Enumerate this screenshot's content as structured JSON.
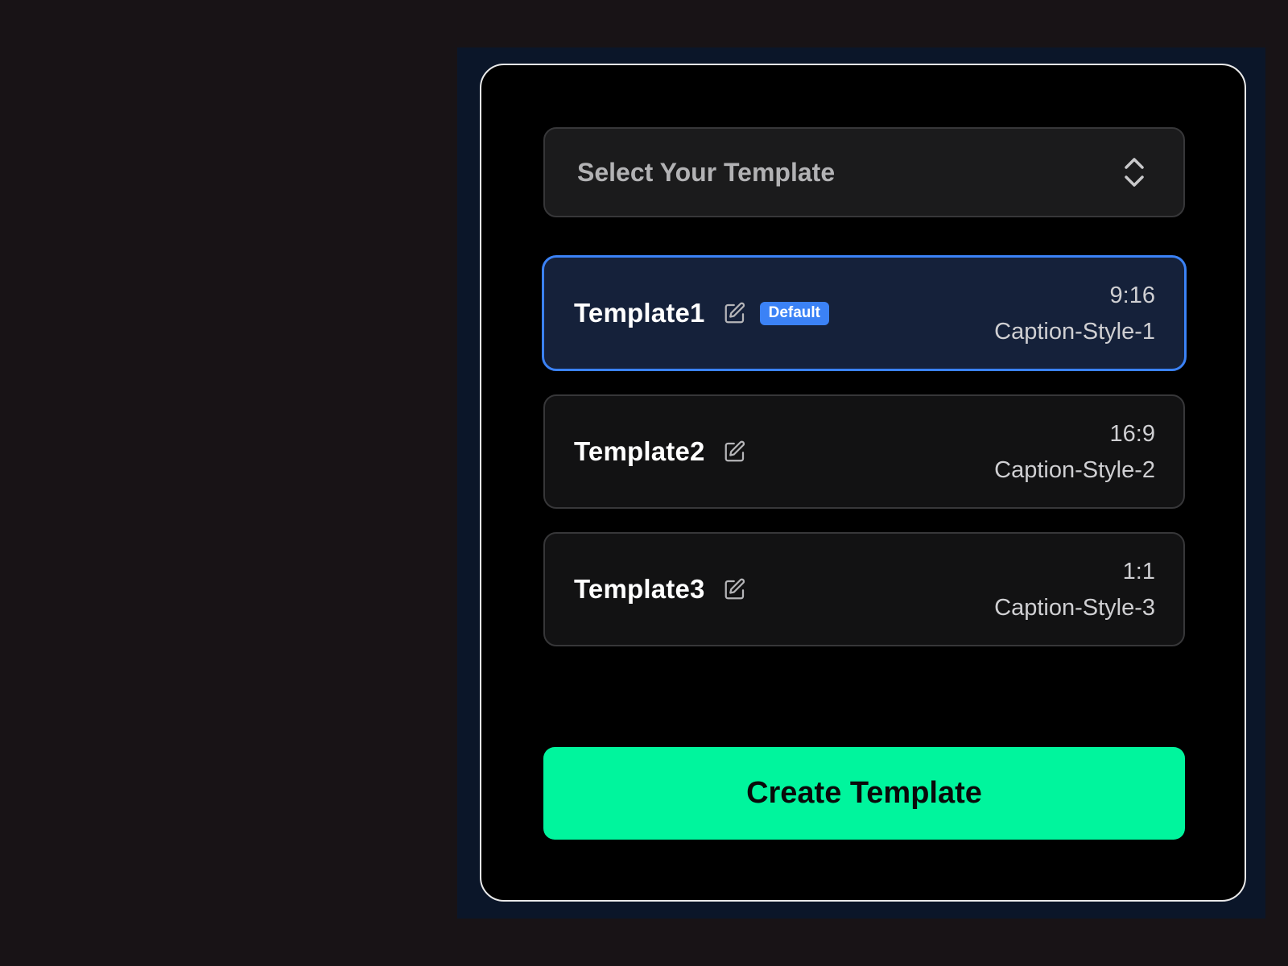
{
  "selector": {
    "label": "Select Your Template",
    "icon": "chevron-up-down-icon"
  },
  "templates": [
    {
      "name": "Template1",
      "ratio": "9:16",
      "caption_style": "Caption-Style-1",
      "badge": "Default",
      "selected": true
    },
    {
      "name": "Template2",
      "ratio": "16:9",
      "caption_style": "Caption-Style-2",
      "badge": null,
      "selected": false
    },
    {
      "name": "Template3",
      "ratio": "1:1",
      "caption_style": "Caption-Style-3",
      "badge": null,
      "selected": false
    }
  ],
  "create_button": {
    "label": "Create Template"
  },
  "colors": {
    "page_background": "#181316",
    "backdrop": "#0b1629",
    "panel_background": "#000000",
    "panel_border": "#e9e9e9",
    "selected_border": "#3b82f6",
    "selected_background": "#15213a",
    "badge": "#3b82f6",
    "accent_button": "#00f59d"
  }
}
